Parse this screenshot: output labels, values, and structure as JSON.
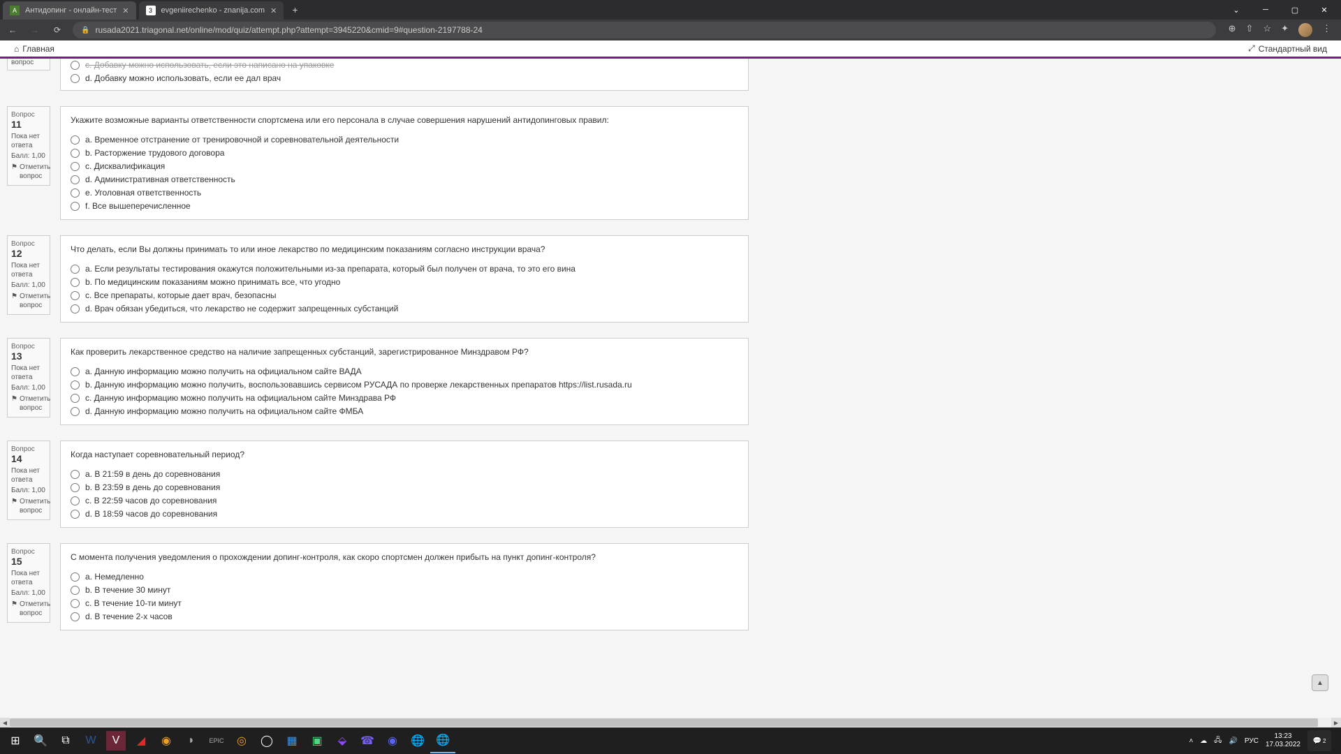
{
  "browser": {
    "tabs": [
      {
        "title": "Антидопинг - онлайн-тест",
        "icon": "A"
      },
      {
        "title": "evgeniirechenko - znanija.com",
        "icon": "3"
      }
    ],
    "url": "rusada2021.triagonal.net/online/mod/quiz/attempt.php?attempt=3945220&cmid=9#question-2197788-24"
  },
  "page_nav": {
    "home": "Главная",
    "std_view": "Стандартный вид"
  },
  "partial_q10": {
    "info_flag": "вопрос",
    "answers": [
      "c. Добавку можно использовать, если это написано на упаковке",
      "d. Добавку можно использовать, если ее дал врач"
    ]
  },
  "questions": [
    {
      "num": "11",
      "label": "Вопрос",
      "status": "Пока нет ответа",
      "score": "Балл: 1,00",
      "flag": "Отметить вопрос",
      "text": "Укажите возможные варианты ответственности спортсмена или его персонала в случае совершения нарушений антидопинговых правил:",
      "answers": [
        "a. Временное отстранение от тренировочной и соревновательной деятельности",
        "b. Расторжение трудового договора",
        "c. Дисквалификация",
        "d. Административная ответственность",
        "e. Уголовная ответственность",
        "f. Все вышеперечисленное"
      ]
    },
    {
      "num": "12",
      "label": "Вопрос",
      "status": "Пока нет ответа",
      "score": "Балл: 1,00",
      "flag": "Отметить вопрос",
      "text": "Что делать, если Вы должны принимать то или иное лекарство по медицинским показаниям согласно инструкции врача?",
      "answers": [
        "a. Если результаты тестирования окажутся положительными из-за препарата, который был получен от врача, то это его вина",
        "b. По медицинским показаниям можно принимать все, что угодно",
        "c. Все препараты, которые дает врач, безопасны",
        "d. Врач обязан убедиться, что лекарство не содержит запрещенных субстанций"
      ]
    },
    {
      "num": "13",
      "label": "Вопрос",
      "status": "Пока нет ответа",
      "score": "Балл: 1,00",
      "flag": "Отметить вопрос",
      "text": "Как проверить лекарственное средство на наличие запрещенных субстанций, зарегистрированное Минздравом РФ?",
      "answers": [
        "a. Данную информацию можно получить на официальном сайте ВАДА",
        "b. Данную информацию можно получить, воспользовавшись сервисом РУСАДА по проверке лекарственных препаратов https://list.rusada.ru",
        "c. Данную информацию можно получить на официальном сайте Минздрава РФ",
        "d. Данную информацию можно получить на официальном сайте ФМБА"
      ]
    },
    {
      "num": "14",
      "label": "Вопрос",
      "status": "Пока нет ответа",
      "score": "Балл: 1,00",
      "flag": "Отметить вопрос",
      "text": "Когда наступает соревновательный период?",
      "answers": [
        "a. В 21:59 в день до соревнования",
        "b. В 23:59 в день до соревнования",
        "c. В 22:59 часов до соревнования",
        "d. В 18:59 часов до соревнования"
      ]
    },
    {
      "num": "15",
      "label": "Вопрос",
      "status": "Пока нет ответа",
      "score": "Балл: 1,00",
      "flag": "Отметить вопрос",
      "text": "С момента получения уведомления о прохождении допинг-контроля, как скоро спортсмен должен прибыть на пункт допинг-контроля?",
      "answers": [
        "a. Немедленно",
        "b. В течение 30 минут",
        "c. В течение 10-ти минут",
        "d. В течение 2-х часов"
      ]
    }
  ],
  "taskbar": {
    "time": "13:23",
    "date": "17.03.2022",
    "lang": "РУС",
    "notif": "2"
  }
}
